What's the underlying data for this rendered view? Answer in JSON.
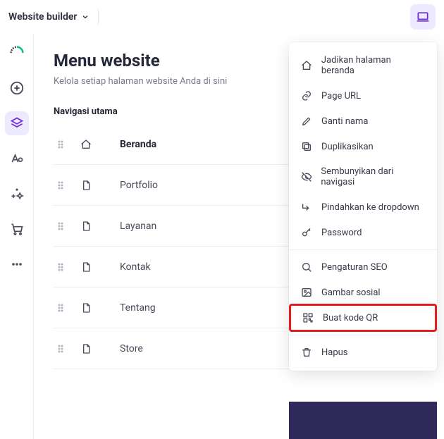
{
  "topbar": {
    "title": "Website builder"
  },
  "panel": {
    "title": "Menu website",
    "subtitle": "Kelola setiap halaman website Anda di sini",
    "section_label": "Navigasi utama"
  },
  "pages": [
    {
      "name": "Beranda",
      "icon": "home",
      "bold": true
    },
    {
      "name": "Portfolio",
      "icon": "page",
      "bold": false
    },
    {
      "name": "Layanan",
      "icon": "page",
      "bold": false
    },
    {
      "name": "Kontak",
      "icon": "page",
      "bold": false,
      "gear_highlight": true
    },
    {
      "name": "Tentang",
      "icon": "page",
      "bold": false
    },
    {
      "name": "Store",
      "icon": "page",
      "bold": false
    }
  ],
  "ctx_menu": [
    {
      "icon": "home",
      "label": "Jadikan halaman beranda"
    },
    {
      "icon": "link",
      "label": "Page URL"
    },
    {
      "icon": "pencil",
      "label": "Ganti nama"
    },
    {
      "icon": "copy",
      "label": "Duplikasikan"
    },
    {
      "icon": "eye-off",
      "label": "Sembunyikan dari navigasi"
    },
    {
      "icon": "corner",
      "label": "Pindahkan ke dropdown"
    },
    {
      "icon": "key",
      "label": "Password"
    },
    {
      "sep": true
    },
    {
      "icon": "search",
      "label": "Pengaturan SEO"
    },
    {
      "icon": "image",
      "label": "Gambar sosial"
    },
    {
      "icon": "qr",
      "label": "Buat kode QR",
      "highlight": true
    },
    {
      "sep": true
    },
    {
      "icon": "trash",
      "label": "Hapus"
    }
  ]
}
